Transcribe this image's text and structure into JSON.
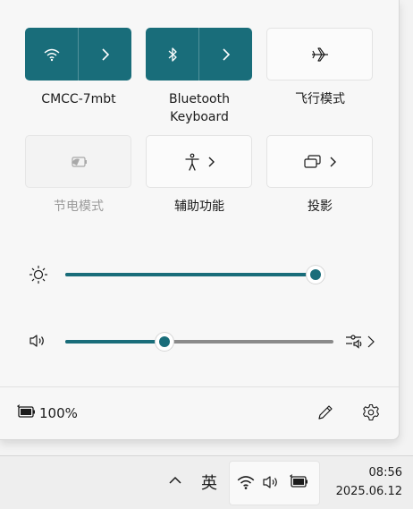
{
  "quick_settings": {
    "tiles": [
      {
        "label": "CMCC-7mbt",
        "icon": "wifi-icon",
        "state": "on"
      },
      {
        "label_line1": "Bluetooth",
        "label_line2": "Keyboard",
        "icon": "bluetooth-icon",
        "state": "on"
      },
      {
        "label": "飞行模式",
        "icon": "airplane-icon",
        "state": "off"
      },
      {
        "label": "节电模式",
        "icon": "battery-saver-icon",
        "state": "disabled"
      },
      {
        "label": "辅助功能",
        "icon": "accessibility-icon",
        "state": "off"
      },
      {
        "label": "投影",
        "icon": "project-icon",
        "state": "off"
      }
    ],
    "brightness_level": 1.0,
    "volume_level": 0.37,
    "battery_text": "100%"
  },
  "taskbar": {
    "ime_label": "英",
    "time": "08:56",
    "date": "2025.06.12"
  },
  "colors": {
    "accent": "#196d7a"
  }
}
